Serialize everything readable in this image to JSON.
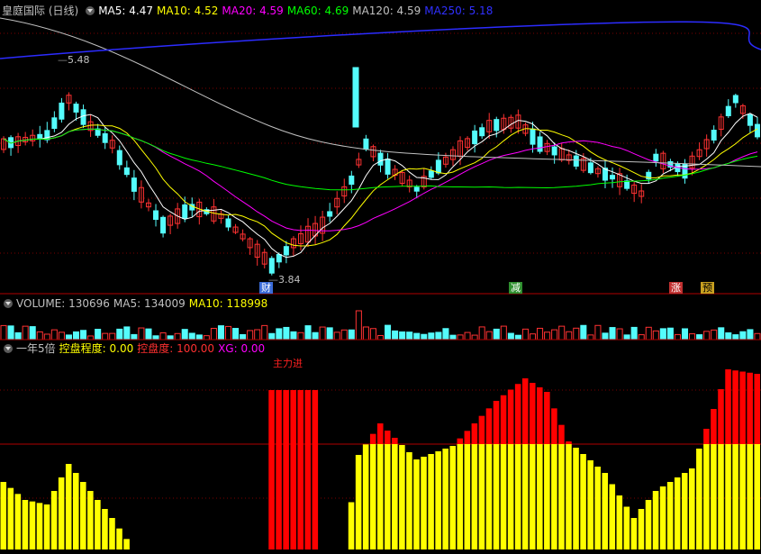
{
  "price_panel": {
    "title": "皇庭国际 (日线)",
    "ma": [
      {
        "label": "MA5: 4.47",
        "color": "#ffffff"
      },
      {
        "label": "MA10: 4.52",
        "color": "#ffff00"
      },
      {
        "label": "MA20: 4.59",
        "color": "#ff00ff"
      },
      {
        "label": "MA60: 4.69",
        "color": "#00ff00"
      },
      {
        "label": "MA120: 4.59",
        "color": "#c0c0c0"
      },
      {
        "label": "MA250: 5.18",
        "color": "#3030ff"
      }
    ],
    "high_label": "5.48",
    "low_label": "3.84",
    "badges": [
      {
        "text": "财",
        "bg": "#3a6bd8",
        "color": "#ffffff"
      },
      {
        "text": "减",
        "bg": "#2f8f2f",
        "color": "#ffffff"
      },
      {
        "text": "涨",
        "bg": "#c03030",
        "color": "#ffffff"
      },
      {
        "text": "预",
        "bg": "#c8a020",
        "color": "#000000"
      }
    ]
  },
  "volume_panel": {
    "items": [
      {
        "label": "VOLUME: 130696",
        "color": "#c0c0c0"
      },
      {
        "label": "MA5: 134009",
        "color": "#c0c0c0"
      },
      {
        "label": "MA10: 118998",
        "color": "#ffff00"
      }
    ]
  },
  "indicator_panel": {
    "items": [
      {
        "label": "一年5倍",
        "color": "#c0c0c0"
      },
      {
        "label": "控盘程度: 0.00",
        "color": "#ffff00"
      },
      {
        "label": "控盘度: 100.00",
        "color": "#ff3030"
      },
      {
        "label": "XG: 0.00",
        "color": "#ff00ff"
      }
    ],
    "marker_text": "主力进"
  },
  "colors": {
    "up": "#ff3232",
    "down": "#54fcfc",
    "grid": "#7a0000",
    "indicator_fill": "#ffff00",
    "indicator_red": "#ff0000"
  }
}
